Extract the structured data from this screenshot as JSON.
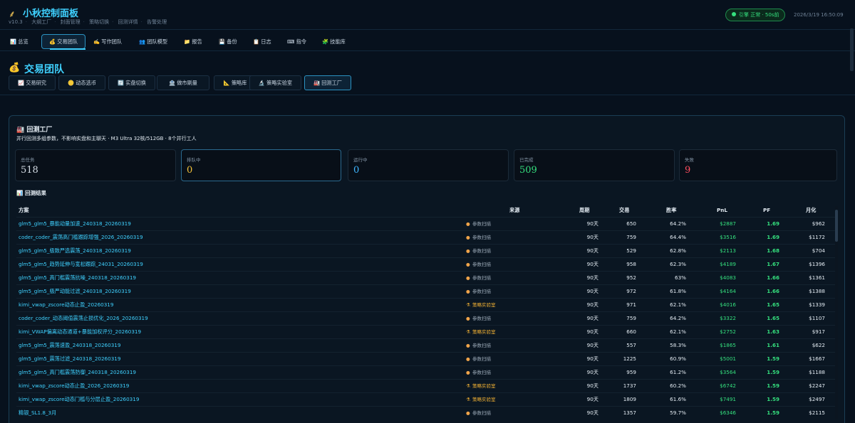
{
  "app": {
    "title": "小秋控制面板",
    "logo_icon": "wheat-icon",
    "subnav": [
      "v10.3",
      "大纲工厂",
      "封面管理",
      "策略切换",
      "回测详情",
      "告警处理"
    ],
    "status": "引擎 正常 · 50s前",
    "datetime": "2026/3/19 16:50:09"
  },
  "main_tabs": [
    {
      "icon": "📊",
      "label": "总览"
    },
    {
      "icon": "💰",
      "label": "交易团队",
      "active": true
    },
    {
      "icon": "✍️",
      "label": "写作团队"
    },
    {
      "icon": "👥",
      "label": "团队模型"
    },
    {
      "icon": "📁",
      "label": "报告"
    },
    {
      "icon": "💾",
      "label": "备份"
    },
    {
      "icon": "📋",
      "label": "日志"
    },
    {
      "icon": "⌨",
      "label": "指令"
    },
    {
      "icon": "🧩",
      "label": "技能库"
    }
  ],
  "section": {
    "icon": "💰",
    "title": "交易团队"
  },
  "sub_tabs": [
    {
      "icon": "📈",
      "label": "交易研究"
    },
    {
      "icon": "🪙",
      "label": "动态选币"
    },
    {
      "icon": "🔄",
      "label": "实盘切换"
    },
    {
      "icon": "🏦",
      "label": "做市刷量"
    },
    {
      "icon": "📐",
      "label": "策略库"
    },
    {
      "icon": "🔬",
      "label": "策略实验室"
    },
    {
      "icon": "🏭",
      "label": "回测工厂",
      "active": true
    }
  ],
  "card": {
    "title": "回测工厂",
    "title_icon": "🏭",
    "subtitle": "并行回测多组参数，不影响实盘和主聊天 · M3 Ultra 32核/512GB · 8个并行工人"
  },
  "stats": [
    {
      "label": "总任务",
      "value": "518",
      "color": "#d6dee6"
    },
    {
      "label": "排队中",
      "value": "0",
      "color": "#f3c23a"
    },
    {
      "label": "运行中",
      "value": "0",
      "color": "#3fb6ff"
    },
    {
      "label": "已完成",
      "value": "509",
      "color": "#35e07e"
    },
    {
      "label": "失败",
      "value": "9",
      "color": "#ff4d5e"
    }
  ],
  "results": {
    "title": "回测结果",
    "title_icon": "📊",
    "columns": {
      "name": "方案",
      "source": "来源",
      "period": "周期",
      "trades": "交易",
      "winrate": "胜率",
      "pnl": "PnL",
      "pf": "PF",
      "monthly": "月化"
    },
    "rows": [
      {
        "name": "glm5_glm5_暴能动量加速_240318_20260319",
        "source": "参数扫描",
        "period": "90天",
        "trades": "650",
        "winrate": "64.2%",
        "pnl": "$2887",
        "pf": "1.69",
        "monthly": "$962"
      },
      {
        "name": "coder_coder_震荡高门槛跟踪增强_2026_20260319",
        "source": "参数扫描",
        "period": "90天",
        "trades": "759",
        "winrate": "64.4%",
        "pnl": "$3516",
        "pf": "1.69",
        "monthly": "$1172"
      },
      {
        "name": "glm5_glm5_极致严选震荡_240318_20260319",
        "source": "参数扫描",
        "period": "90天",
        "trades": "529",
        "winrate": "62.8%",
        "pnl": "$2113",
        "pf": "1.68",
        "monthly": "$704"
      },
      {
        "name": "glm5_glm5_趋势延伸与宽松跟踪_24031_20260319",
        "source": "参数扫描",
        "period": "90天",
        "trades": "958",
        "winrate": "62.3%",
        "pnl": "$4189",
        "pf": "1.67",
        "monthly": "$1396"
      },
      {
        "name": "glm5_glm5_高门槛震荡抗噪_240318_20260319",
        "source": "参数扫描",
        "period": "90天",
        "trades": "952",
        "winrate": "63%",
        "pnl": "$4083",
        "pf": "1.66",
        "monthly": "$1361"
      },
      {
        "name": "glm5_glm5_极严动能过滤_240318_20260319",
        "source": "参数扫描",
        "period": "90天",
        "trades": "972",
        "winrate": "61.8%",
        "pnl": "$4164",
        "pf": "1.66",
        "monthly": "$1388"
      },
      {
        "name": "kimi_vwap_zscore动态止盈_20260319",
        "source": "策略实验室",
        "period": "90天",
        "trades": "971",
        "winrate": "62.1%",
        "pnl": "$4016",
        "pf": "1.65",
        "monthly": "$1339"
      },
      {
        "name": "coder_coder_动态阈值震荡止损优化_2026_20260319",
        "source": "参数扫描",
        "period": "90天",
        "trades": "759",
        "winrate": "64.2%",
        "pnl": "$3322",
        "pf": "1.65",
        "monthly": "$1107"
      },
      {
        "name": "kimi_VWAP偏离动态通道+暴能加权评分_20260319",
        "source": "策略实验室",
        "period": "90天",
        "trades": "660",
        "winrate": "62.1%",
        "pnl": "$2752",
        "pf": "1.63",
        "monthly": "$917"
      },
      {
        "name": "glm5_glm5_震荡速盈_240318_20260319",
        "source": "参数扫描",
        "period": "90天",
        "trades": "557",
        "winrate": "58.3%",
        "pnl": "$1865",
        "pf": "1.61",
        "monthly": "$622"
      },
      {
        "name": "glm5_glm5_震荡过滤_240318_20260319",
        "source": "参数扫描",
        "period": "90天",
        "trades": "1225",
        "winrate": "60.9%",
        "pnl": "$5001",
        "pf": "1.59",
        "monthly": "$1667"
      },
      {
        "name": "glm5_glm5_高门槛震荡防御_240318_20260319",
        "source": "参数扫描",
        "period": "90天",
        "trades": "959",
        "winrate": "61.2%",
        "pnl": "$3564",
        "pf": "1.59",
        "monthly": "$1188"
      },
      {
        "name": "kimi_vwap_zscore动态止盈_2026_20260319",
        "source": "策略实验室",
        "period": "90天",
        "trades": "1737",
        "winrate": "60.2%",
        "pnl": "$6742",
        "pf": "1.59",
        "monthly": "$2247"
      },
      {
        "name": "kimi_vwap_zscore动态门槛与分层止盈_20260319",
        "source": "策略实验室",
        "period": "90天",
        "trades": "1809",
        "winrate": "61.6%",
        "pnl": "$7491",
        "pf": "1.59",
        "monthly": "$2497"
      },
      {
        "name": "精银_SL1.8_3月",
        "source": "参数扫描",
        "period": "90天",
        "trades": "1357",
        "winrate": "59.7%",
        "pnl": "$6346",
        "pf": "1.59",
        "monthly": "$2115"
      }
    ]
  }
}
